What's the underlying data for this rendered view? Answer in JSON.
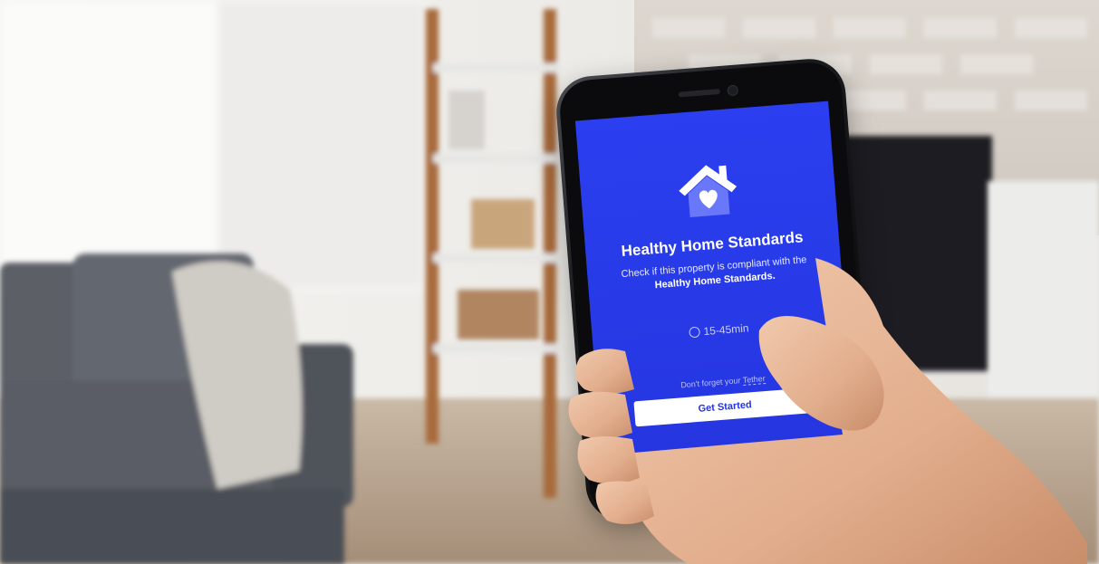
{
  "app": {
    "title": "Healthy Home Standards",
    "description_lead": "Check if this property is compliant with the ",
    "description_strong": "Healthy Home Standards.",
    "duration": "15-45min",
    "reminder_lead": "Don't forget your ",
    "reminder_link": "Tether",
    "cta_label": "Get Started"
  },
  "icons": {
    "logo": "house-heart-icon",
    "clock": "clock-icon"
  },
  "colors": {
    "screen_blue": "#2b3ff0",
    "button_text": "#2536e0",
    "button_bg": "#ffffff"
  }
}
